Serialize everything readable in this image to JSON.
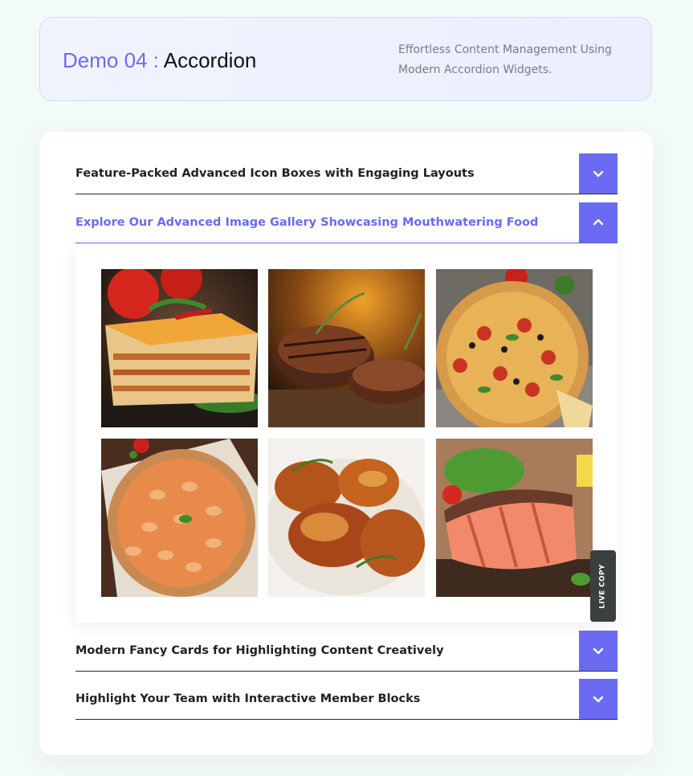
{
  "header": {
    "demo_prefix": "Demo 04 :",
    "demo_name": "Accordion",
    "description": "Effortless Content Management Using Modern Accordion Widgets."
  },
  "accordion": {
    "items": [
      {
        "title": "Feature-Packed Advanced Icon Boxes with Engaging Layouts",
        "expanded": false
      },
      {
        "title": "Explore Our Advanced Image Gallery Showcasing Mouthwatering Food",
        "expanded": true
      },
      {
        "title": "Modern Fancy Cards for Highlighting Content Creatively",
        "expanded": false
      },
      {
        "title": "Highlight Your Team with Interactive Member Blocks",
        "expanded": false
      }
    ]
  },
  "gallery": {
    "images": [
      {
        "subject": "lasagna"
      },
      {
        "subject": "grilled steak"
      },
      {
        "subject": "pizza"
      },
      {
        "subject": "pizza"
      },
      {
        "subject": "roast chicken"
      },
      {
        "subject": "grilled salmon steak"
      }
    ]
  },
  "live_copy_label": "LIVE COPY",
  "colors": {
    "accent": "#6a6bf2",
    "background": "#f3fbf8",
    "toggle_icon": "#ffffff"
  },
  "icons": {
    "collapsed": "chevron-down-icon",
    "expanded": "chevron-up-icon"
  }
}
